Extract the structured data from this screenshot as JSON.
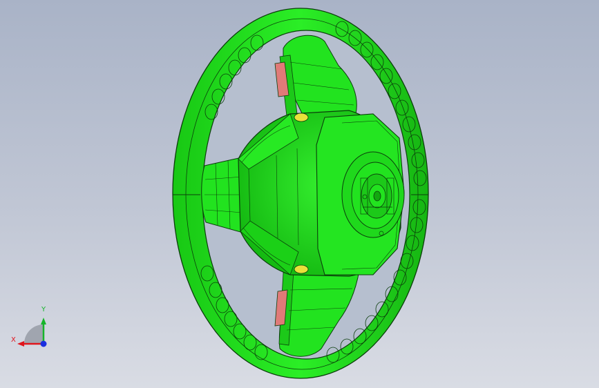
{
  "scene": {
    "model_name": "steering-wheel",
    "colors": {
      "background_top": "#a9b3c7",
      "background_bottom": "#d9dce4",
      "body": "#22e31f",
      "body_dark": "#12a80f",
      "edge": "#0b3d0b",
      "pad_red": "#e07a78",
      "pin_yellow": "#e8e13a"
    }
  },
  "triad": {
    "x_label": "X",
    "y_label": "Y",
    "x_color": "#e0141c",
    "y_color": "#16b52a",
    "z_color": "#1a2fe0"
  }
}
